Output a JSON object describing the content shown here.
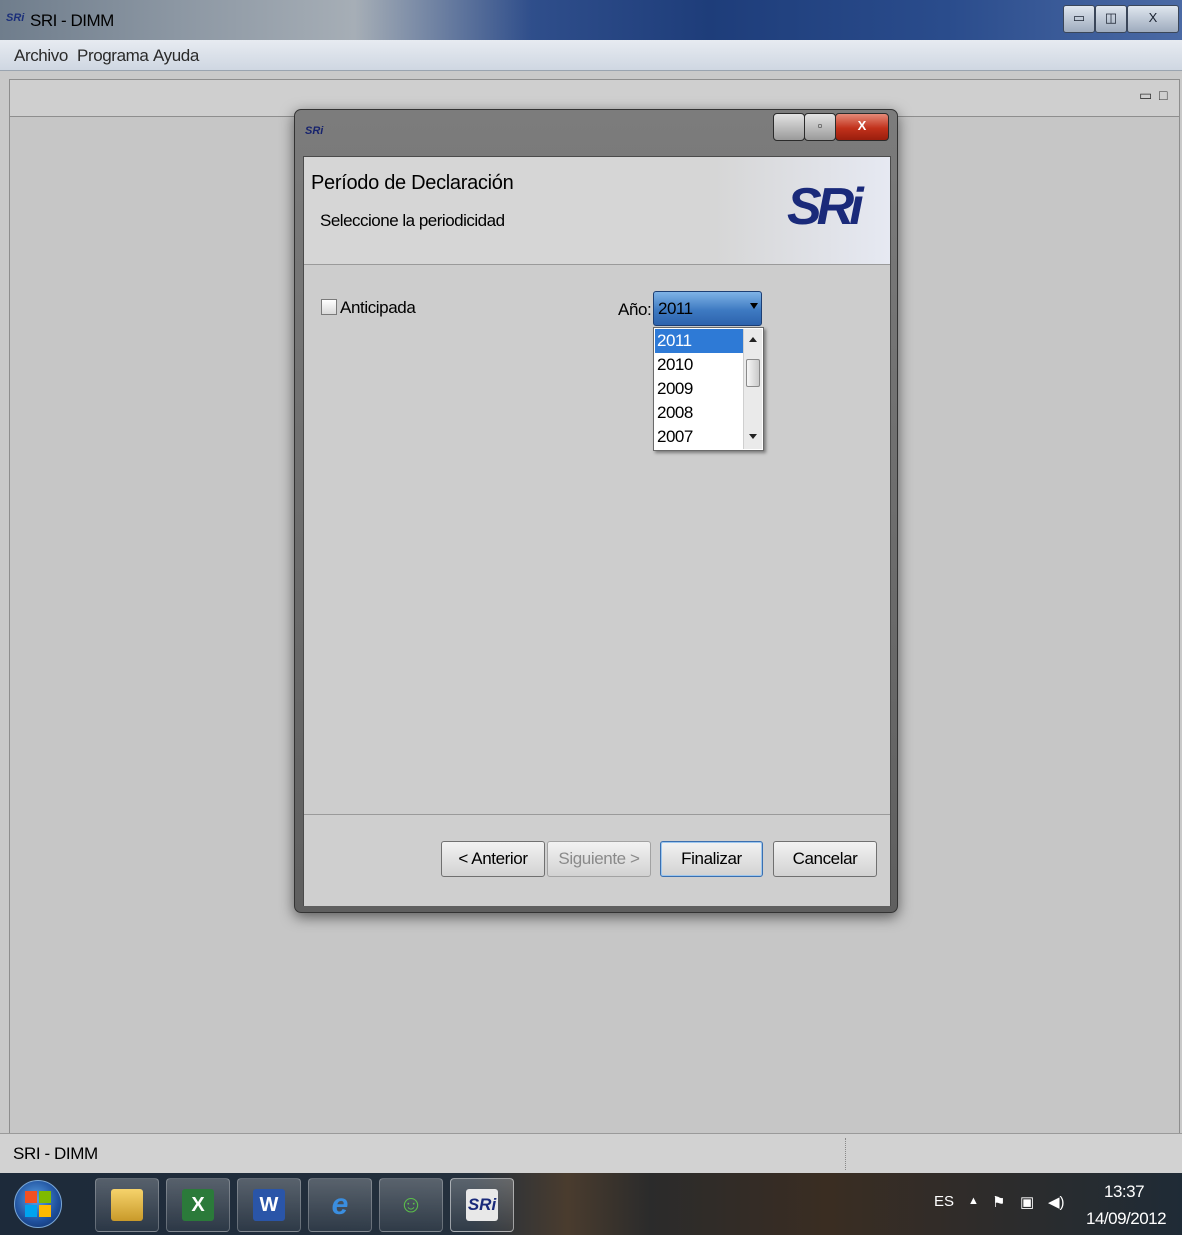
{
  "window": {
    "app_icon_text": "SRi",
    "title": "SRI - DIMM",
    "controls": {
      "minimize": "▭",
      "restore": "◫",
      "close": "X"
    }
  },
  "menu": [
    "Archivo",
    "Programa",
    "Ayuda"
  ],
  "workspace": {
    "minimize_icon": "▭",
    "maximize_icon": "□"
  },
  "dialog": {
    "icon_text": "SRi",
    "controls": {
      "minimize": "",
      "restore": "▫",
      "close": "X"
    },
    "header_title": "Período de Declaración",
    "header_subtitle": "Seleccione la periodicidad",
    "logo_text": "SRi",
    "checkbox_label": "Anticipada",
    "checkbox_checked": false,
    "year_label": "Año:",
    "year_selected": "2011",
    "year_options": [
      "2011",
      "2010",
      "2009",
      "2008",
      "2007"
    ],
    "buttons": {
      "back": "< Anterior",
      "next": "Siguiente >",
      "finish": "Finalizar",
      "cancel": "Cancelar"
    }
  },
  "status_bar": {
    "text": "SRI - DIMM"
  },
  "taskbar": {
    "apps": [
      "folder-icon",
      "excel-icon",
      "word-icon",
      "internet-explorer-icon",
      "messenger-icon",
      "sri-icon"
    ],
    "language": "ES",
    "time": "13:37",
    "date": "14/09/2012"
  },
  "colors": {
    "selection": "#2e7ad6",
    "logo": "#1a2a7a",
    "close_button": "#c1311b"
  }
}
